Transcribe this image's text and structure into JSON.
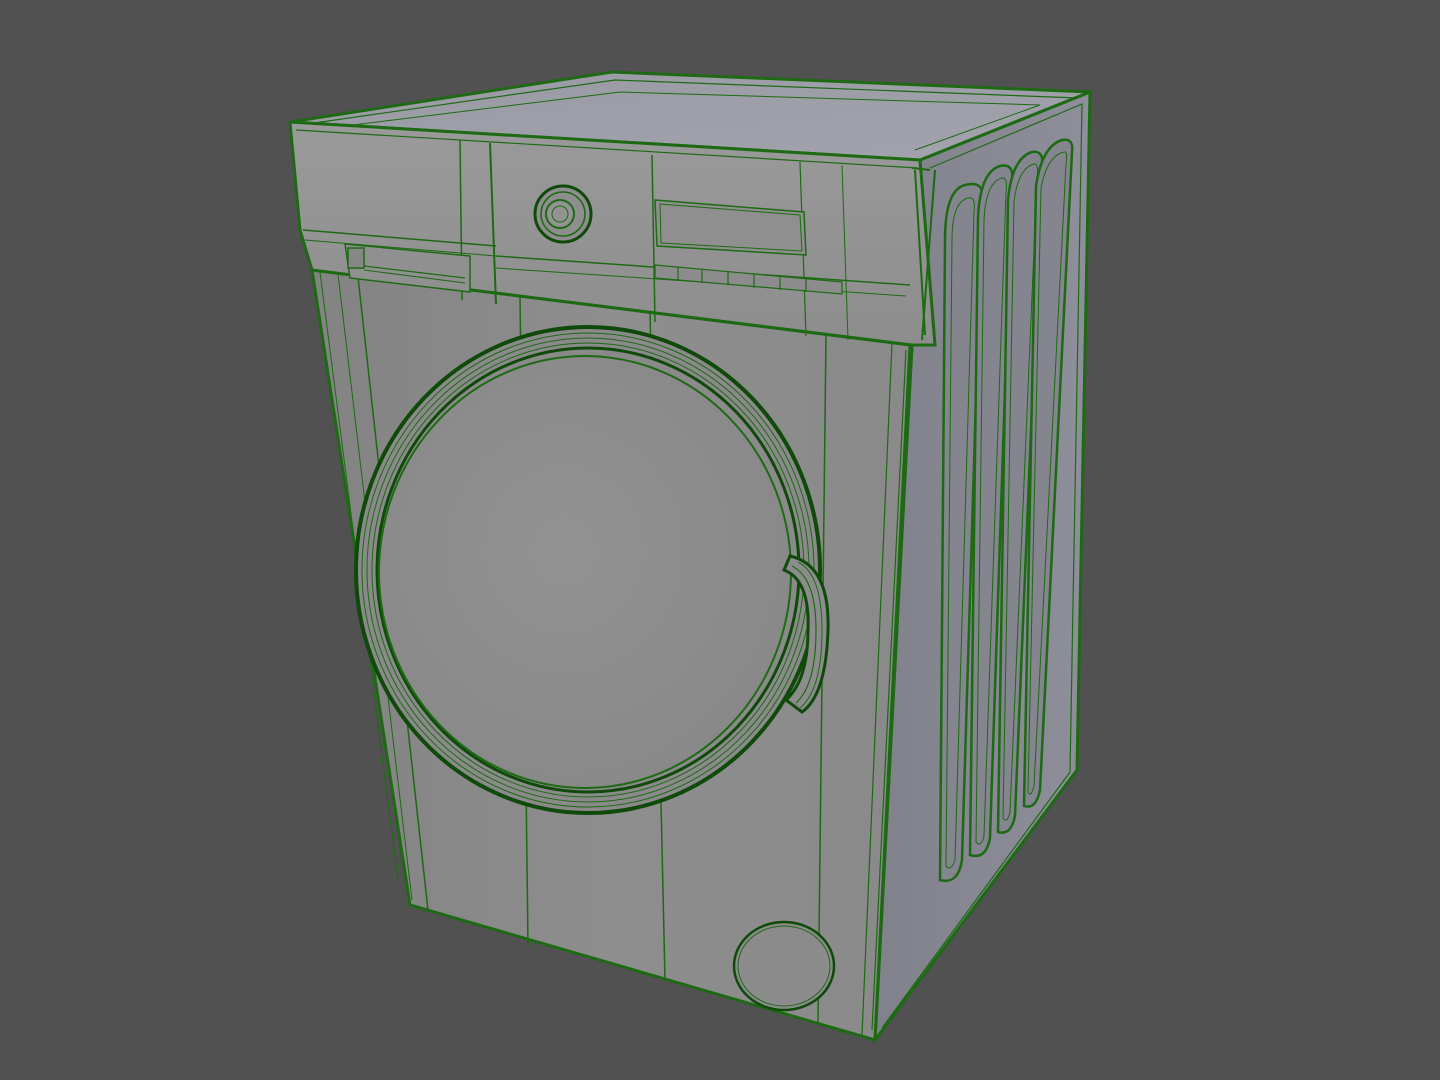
{
  "scene": {
    "subject": "washing-machine",
    "render_style": "wireframe-overlay",
    "colors": {
      "background": "#515151",
      "front_face": "#8c8c8c",
      "top_face": "#9b9ba5",
      "side_face": "#8a8b96",
      "panel_face": "#929292",
      "wire": "#1e6a14",
      "wire_dark": "#0f4a0a"
    },
    "parts": [
      "body",
      "top-panel",
      "control-panel",
      "detergent-drawer",
      "program-knob",
      "display",
      "control-buttons",
      "door-ring",
      "door-glass",
      "door-handle",
      "filter-cover",
      "side-vents"
    ]
  }
}
